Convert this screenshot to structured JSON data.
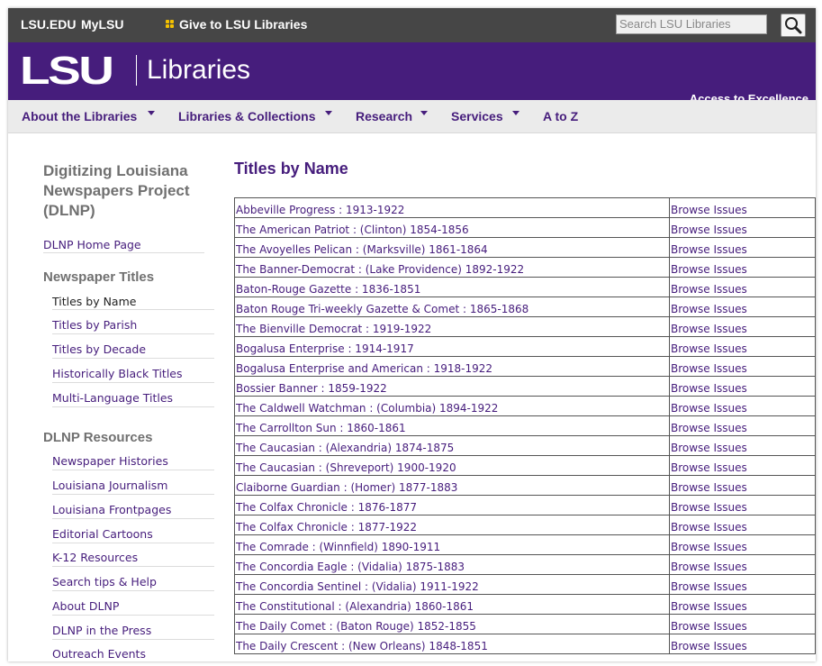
{
  "topbar": {
    "links": [
      "LSU.EDU",
      "MyLSU"
    ],
    "give_label": "Give to LSU Libraries",
    "search_placeholder": "Search LSU Libraries"
  },
  "banner": {
    "logo_text": "LSU",
    "logo_libraries": "Libraries",
    "tagline": "Access to Excellence"
  },
  "nav": {
    "items": [
      "About the Libraries",
      "Libraries & Collections",
      "Research",
      "Services",
      "A to Z"
    ]
  },
  "sidebar": {
    "title": "Digitizing Louisiana Newspapers Project (DLNP)",
    "home_link": "DLNP Home Page",
    "section1_head": "Newspaper Titles",
    "section1_items": [
      "Titles by Name",
      "Titles by Parish",
      "Titles by Decade",
      "Historically Black Titles",
      "Multi-Language Titles"
    ],
    "section2_head": "DLNP Resources",
    "section2_items": [
      "Newspaper Histories",
      "Louisiana Journalism",
      "Louisiana Frontpages",
      "Editorial Cartoons",
      "K-12 Resources",
      "Search tips & Help",
      "About DLNP",
      "DLNP in the Press",
      "Outreach Events"
    ]
  },
  "main": {
    "title": "Titles by Name",
    "browse_label": "Browse Issues",
    "rows": [
      "Abbeville Progress : 1913-1922",
      "The American Patriot : (Clinton) 1854-1856",
      "The Avoyelles Pelican : (Marksville) 1861-1864",
      "The Banner-Democrat : (Lake Providence) 1892-1922",
      "Baton-Rouge Gazette : 1836-1851",
      "Baton Rouge Tri-weekly Gazette & Comet : 1865-1868",
      "The Bienville Democrat : 1919-1922",
      "Bogalusa Enterprise : 1914-1917",
      "Bogalusa Enterprise and American : 1918-1922",
      "Bossier Banner : 1859-1922",
      "The Caldwell Watchman : (Columbia) 1894-1922",
      "The Carrollton Sun : 1860-1861",
      "The Caucasian : (Alexandria) 1874-1875",
      "The Caucasian : (Shreveport) 1900-1920",
      "Claiborne Guardian : (Homer) 1877-1883",
      "The Colfax Chronicle : 1876-1877",
      "The Colfax Chronicle : 1877-1922",
      "The Comrade : (Winnfield) 1890-1911",
      "The Concordia Eagle : (Vidalia) 1875-1883",
      "The Concordia Sentinel : (Vidalia) 1911-1922",
      "The Constitutional : (Alexandria) 1860-1861",
      "The Daily Comet : (Baton Rouge) 1852-1855",
      "The Daily Crescent : (New Orleans) 1848-1851"
    ]
  },
  "colors": {
    "purple": "#461d7c",
    "topbar": "#464646",
    "gold": "#f5c200"
  }
}
